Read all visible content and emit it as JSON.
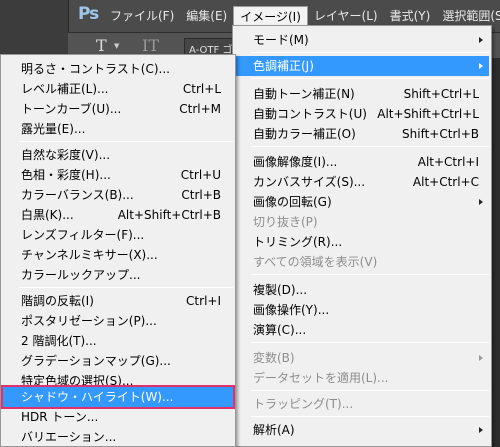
{
  "app": {
    "logo": "Ps",
    "font_field": "A-OTF ゴ"
  },
  "menubar": [
    "ファイル(F)",
    "編集(E)",
    "イメージ(I)",
    "レイヤー(L)",
    "書式(Y)",
    "選択範囲(S)"
  ],
  "image_menu": {
    "items": [
      {
        "label": "モード(M)",
        "shortcut": "",
        "arrow": true,
        "disabled": false
      },
      {
        "label": "色調補正(J)",
        "shortcut": "",
        "arrow": true,
        "disabled": false,
        "highlighted": true
      },
      {
        "label": "自動トーン補正(N)",
        "shortcut": "Shift+Ctrl+L",
        "arrow": false,
        "disabled": false
      },
      {
        "label": "自動コントラスト(U)",
        "shortcut": "Alt+Shift+Ctrl+L",
        "arrow": false,
        "disabled": false
      },
      {
        "label": "自動カラー補正(O)",
        "shortcut": "Shift+Ctrl+B",
        "arrow": false,
        "disabled": false
      },
      {
        "label": "画像解像度(I)...",
        "shortcut": "Alt+Ctrl+I",
        "arrow": false,
        "disabled": false
      },
      {
        "label": "カンバスサイズ(S)...",
        "shortcut": "Alt+Ctrl+C",
        "arrow": false,
        "disabled": false
      },
      {
        "label": "画像の回転(G)",
        "shortcut": "",
        "arrow": true,
        "disabled": false
      },
      {
        "label": "切り抜き(P)",
        "shortcut": "",
        "arrow": false,
        "disabled": true
      },
      {
        "label": "トリミング(R)...",
        "shortcut": "",
        "arrow": false,
        "disabled": false
      },
      {
        "label": "すべての領域を表示(V)",
        "shortcut": "",
        "arrow": false,
        "disabled": true
      },
      {
        "label": "複製(D)...",
        "shortcut": "",
        "arrow": false,
        "disabled": false
      },
      {
        "label": "画像操作(Y)...",
        "shortcut": "",
        "arrow": false,
        "disabled": false
      },
      {
        "label": "演算(C)...",
        "shortcut": "",
        "arrow": false,
        "disabled": false
      },
      {
        "label": "変数(B)",
        "shortcut": "",
        "arrow": true,
        "disabled": true
      },
      {
        "label": "データセットを適用(L)...",
        "shortcut": "",
        "arrow": false,
        "disabled": true
      },
      {
        "label": "トラッピング(T)...",
        "shortcut": "",
        "arrow": false,
        "disabled": true
      },
      {
        "label": "解析(A)",
        "shortcut": "",
        "arrow": true,
        "disabled": false
      }
    ]
  },
  "adjust_menu": {
    "items": [
      {
        "label": "明るさ・コントラスト(C)...",
        "shortcut": ""
      },
      {
        "label": "レベル補正(L)...",
        "shortcut": "Ctrl+L"
      },
      {
        "label": "トーンカーブ(U)...",
        "shortcut": "Ctrl+M"
      },
      {
        "label": "露光量(E)...",
        "shortcut": ""
      },
      {
        "label": "自然な彩度(V)...",
        "shortcut": ""
      },
      {
        "label": "色相・彩度(H)...",
        "shortcut": "Ctrl+U"
      },
      {
        "label": "カラーバランス(B)...",
        "shortcut": "Ctrl+B"
      },
      {
        "label": "白黒(K)...",
        "shortcut": "Alt+Shift+Ctrl+B"
      },
      {
        "label": "レンズフィルター(F)...",
        "shortcut": ""
      },
      {
        "label": "チャンネルミキサー(X)...",
        "shortcut": ""
      },
      {
        "label": "カラールックアップ...",
        "shortcut": ""
      },
      {
        "label": "階調の反転(I)",
        "shortcut": "Ctrl+I"
      },
      {
        "label": "ポスタリゼーション(P)...",
        "shortcut": ""
      },
      {
        "label": "2 階調化(T)...",
        "shortcut": ""
      },
      {
        "label": "グラデーションマップ(G)...",
        "shortcut": ""
      },
      {
        "label": "特定色域の選択(S)...",
        "shortcut": ""
      },
      {
        "label": "シャドウ・ハイライト(W)...",
        "shortcut": "",
        "highlighted": true
      },
      {
        "label": "HDR トーン...",
        "shortcut": ""
      },
      {
        "label": "バリエーション...",
        "shortcut": ""
      }
    ]
  },
  "colors": {
    "highlight": "#3399ff",
    "selection_frame": "#e32f6b"
  }
}
